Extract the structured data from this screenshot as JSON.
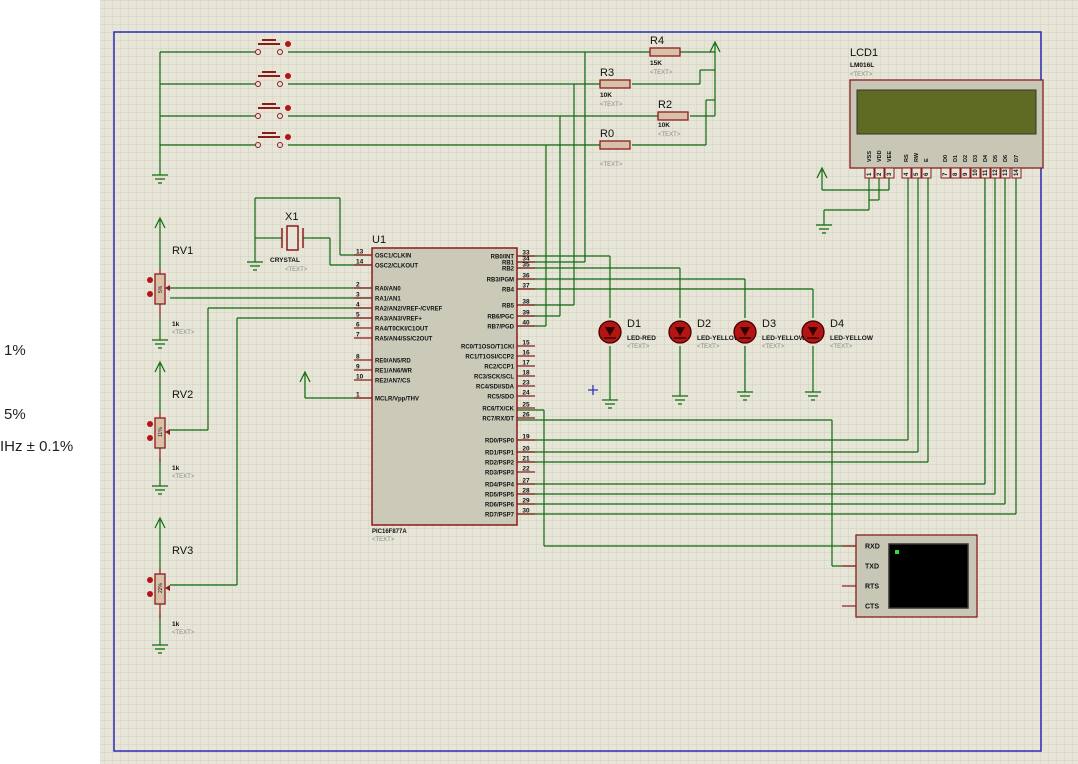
{
  "side_panel": {
    "lines": [
      "1%",
      "5%",
      "IHz ± 0.1%"
    ]
  },
  "components": {
    "u1": {
      "ref": "U1",
      "part": "PIC16F877A",
      "text": "<TEXT>",
      "left_pins": [
        {
          "num": "13",
          "name": "OSC1/CLKIN"
        },
        {
          "num": "14",
          "name": "OSC2/CLKOUT"
        },
        {
          "num": "2",
          "name": "RA0/AN0"
        },
        {
          "num": "3",
          "name": "RA1/AN1"
        },
        {
          "num": "4",
          "name": "RA2/AN2/VREF-/CVREF"
        },
        {
          "num": "5",
          "name": "RA3/AN3/VREF+"
        },
        {
          "num": "6",
          "name": "RA4/T0CKI/C1OUT"
        },
        {
          "num": "7",
          "name": "RA5/AN4/SS/C2OUT"
        },
        {
          "num": "8",
          "name": "RE0/AN5/RD"
        },
        {
          "num": "9",
          "name": "RE1/AN6/WR"
        },
        {
          "num": "10",
          "name": "RE2/AN7/CS"
        },
        {
          "num": "1",
          "name": "MCLR/Vpp/THV"
        }
      ],
      "right_pins": [
        {
          "num": "33",
          "name": "RB0/INT"
        },
        {
          "num": "34",
          "name": "RB1"
        },
        {
          "num": "35",
          "name": "RB2"
        },
        {
          "num": "36",
          "name": "RB3/PGM"
        },
        {
          "num": "37",
          "name": "RB4"
        },
        {
          "num": "38",
          "name": "RB5"
        },
        {
          "num": "39",
          "name": "RB6/PGC"
        },
        {
          "num": "40",
          "name": "RB7/PGD"
        },
        {
          "num": "15",
          "name": "RC0/T1OSO/T1CKI"
        },
        {
          "num": "16",
          "name": "RC1/T1OSI/CCP2"
        },
        {
          "num": "17",
          "name": "RC2/CCP1"
        },
        {
          "num": "18",
          "name": "RC3/SCK/SCL"
        },
        {
          "num": "23",
          "name": "RC4/SDI/SDA"
        },
        {
          "num": "24",
          "name": "RC5/SDO"
        },
        {
          "num": "25",
          "name": "RC6/TX/CK"
        },
        {
          "num": "26",
          "name": "RC7/RX/DT"
        },
        {
          "num": "19",
          "name": "RD0/PSP0"
        },
        {
          "num": "20",
          "name": "RD1/PSP1"
        },
        {
          "num": "21",
          "name": "RD2/PSP2"
        },
        {
          "num": "22",
          "name": "RD3/PSP3"
        },
        {
          "num": "27",
          "name": "RD4/PSP4"
        },
        {
          "num": "28",
          "name": "RD5/PSP5"
        },
        {
          "num": "29",
          "name": "RD6/PSP6"
        },
        {
          "num": "30",
          "name": "RD7/PSP7"
        }
      ]
    },
    "x1": {
      "ref": "X1",
      "part": "CRYSTAL",
      "text": "<TEXT>"
    },
    "resistors": [
      {
        "ref": "R4",
        "value": "15K",
        "text": "<TEXT>"
      },
      {
        "ref": "R3",
        "value": "10K",
        "text": "<TEXT>"
      },
      {
        "ref": "R2",
        "value": "10K",
        "text": "<TEXT>"
      },
      {
        "ref": "R0",
        "value": "",
        "text": "<TEXT>"
      }
    ],
    "pots": [
      {
        "ref": "RV1",
        "value": "1k",
        "text": "<TEXT>",
        "body": "5%"
      },
      {
        "ref": "RV2",
        "value": "1k",
        "text": "<TEXT>",
        "body": "11%"
      },
      {
        "ref": "RV3",
        "value": "1k",
        "text": "<TEXT>",
        "body": "22%"
      }
    ],
    "leds": [
      {
        "ref": "D1",
        "part": "LED-RED",
        "text": "<TEXT>"
      },
      {
        "ref": "D2",
        "part": "LED-YELLOW",
        "text": "<TEXT>"
      },
      {
        "ref": "D3",
        "part": "LED-YELLOW",
        "text": "<TEXT>"
      },
      {
        "ref": "D4",
        "part": "LED-YELLOW",
        "text": "<TEXT>"
      }
    ],
    "lcd": {
      "ref": "LCD1",
      "part": "LM016L",
      "text": "<TEXT>",
      "pin_names": [
        "VSS",
        "VDD",
        "VEE",
        "RS",
        "RW",
        "E",
        "D0",
        "D1",
        "D2",
        "D3",
        "D4",
        "D5",
        "D6",
        "D7"
      ],
      "pin_nums": [
        "1",
        "2",
        "3",
        "4",
        "5",
        "6",
        "7",
        "8",
        "9",
        "10",
        "11",
        "12",
        "13",
        "14"
      ]
    },
    "terminal": {
      "pins": [
        "RXD",
        "TXD",
        "RTS",
        "CTS"
      ]
    }
  },
  "colors": {
    "sheet_bg": "#e7e5d8",
    "grid": "#d2cfbe",
    "border": "#2c2cb5",
    "wire": "#0f6a0f",
    "outline": "#8a1c1c",
    "chip_fill": "#cbc9b8",
    "lcd_fill": "#c8c7b5",
    "lcd_screen": "#5f6a22",
    "led": "#b31414",
    "pin_red": "#b31414",
    "label": "#111111",
    "text_tag": "#8a8a8a"
  }
}
